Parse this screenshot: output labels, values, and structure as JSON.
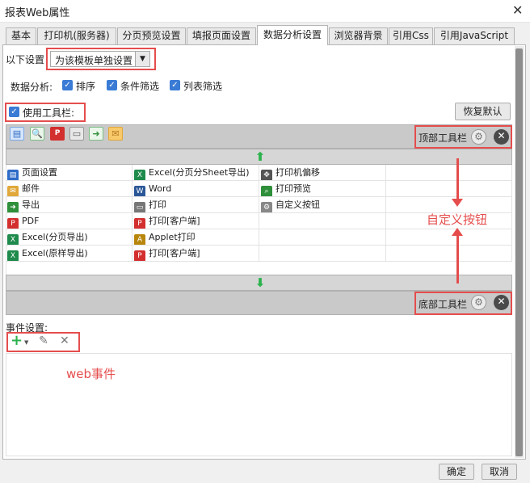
{
  "window": {
    "title": "报表Web属性",
    "close_glyph": "✕"
  },
  "tabs": [
    {
      "label": "基本"
    },
    {
      "label": "打印机(服务器)"
    },
    {
      "label": "分页预览设置"
    },
    {
      "label": "填报页面设置"
    },
    {
      "label": "数据分析设置",
      "active": true
    },
    {
      "label": "浏览器背景"
    },
    {
      "label": "引用Css"
    },
    {
      "label": "引用JavaScript"
    }
  ],
  "settings": {
    "scope_label": "以下设置",
    "scope_value": "为该模板单独设置",
    "analysis_label": "数据分析:",
    "analysis_options": [
      "排序",
      "条件筛选",
      "列表筛选"
    ],
    "use_toolbar_label": "使用工具栏:",
    "restore_default": "恢复默认"
  },
  "top_toolbar": {
    "label": "顶部工具栏"
  },
  "bottom_toolbar": {
    "label": "底部工具栏"
  },
  "toolbar_icons": [
    "page-setup-icon",
    "print-preview-icon",
    "pdf-icon",
    "printer-icon",
    "export-icon",
    "email-icon"
  ],
  "available_buttons": [
    [
      "页面设置",
      "Excel(分页分Sheet导出)",
      "打印机偏移"
    ],
    [
      "邮件",
      "Word",
      "打印预览"
    ],
    [
      "导出",
      "打印",
      "自定义按钮"
    ],
    [
      "PDF",
      "打印[客户端]",
      ""
    ],
    [
      "Excel(分页导出)",
      "Applet打印",
      ""
    ],
    [
      "Excel(原样导出)",
      "打印[客户端]",
      ""
    ]
  ],
  "events": {
    "label": "事件设置:"
  },
  "annotations": {
    "custom_button": "自定义按钮",
    "web_event": "web事件"
  },
  "footer": {
    "ok": "确定",
    "cancel": "取消"
  },
  "colors": {
    "highlight": "#e54d4d",
    "check_blue": "#3a7bd5",
    "arrow_green": "#2bb24c"
  }
}
